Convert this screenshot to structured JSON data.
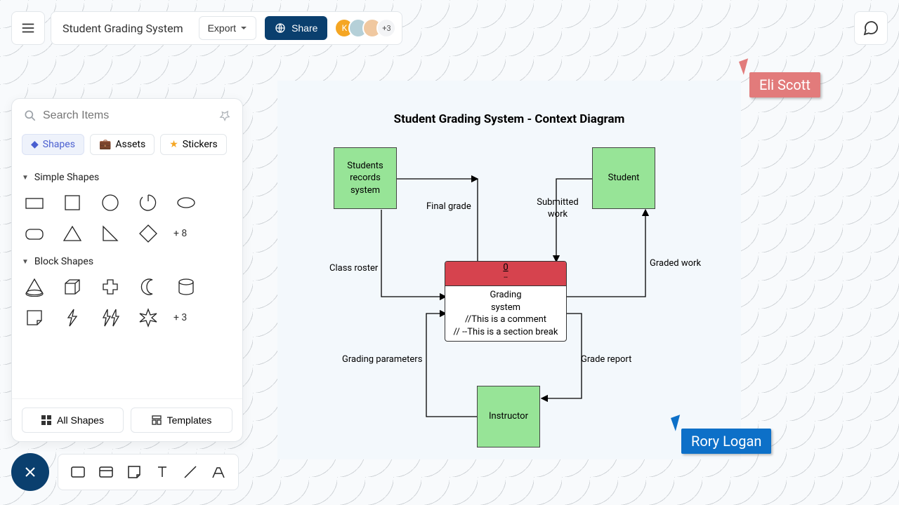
{
  "header": {
    "title": "Student Grading System",
    "export_label": "Export",
    "share_label": "Share",
    "avatar_initial": "K",
    "avatar_more": "+3"
  },
  "search": {
    "placeholder": "Search Items"
  },
  "tabs": {
    "shapes": "Shapes",
    "assets": "Assets",
    "stickers": "Stickers"
  },
  "sections": {
    "simple": {
      "title": "Simple Shapes",
      "more": "+ 8"
    },
    "block": {
      "title": "Block Shapes",
      "more": "+ 3"
    }
  },
  "panel_footer": {
    "all_shapes": "All Shapes",
    "templates": "Templates"
  },
  "diagram": {
    "title": "Student Grading System - Context Diagram",
    "nodes": {
      "records": "Students records system",
      "student": "Student",
      "instructor": "Instructor"
    },
    "process": {
      "head_num": "0",
      "head_dash": "--",
      "line1": "Grading",
      "line2": "system",
      "line3": "//This is a comment",
      "line4": "// --This is a section break"
    },
    "labels": {
      "final_grade": "Final grade",
      "class_roster": "Class roster",
      "submitted_work": "Submitted work",
      "graded_work": "Graded work",
      "grading_params": "Grading parameters",
      "grade_report": "Grade report"
    }
  },
  "cursors": {
    "eli": "Eli Scott",
    "rory": "Rory Logan"
  }
}
